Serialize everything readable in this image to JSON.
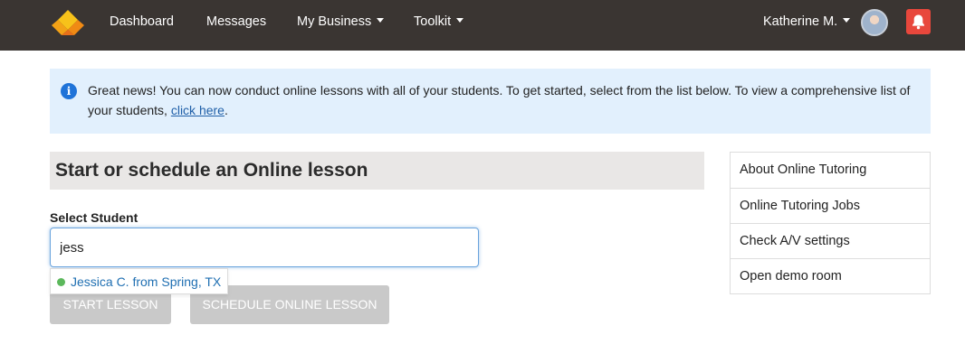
{
  "nav": {
    "links": [
      "Dashboard",
      "Messages",
      "My Business",
      "Toolkit"
    ],
    "user_name": "Katherine M.",
    "logo_icon": "diamond-logo-icon",
    "bell_icon": "bell-icon",
    "bell_color": "#e8473c",
    "bar_color": "#3a3532"
  },
  "alert": {
    "icon": "info-icon",
    "text_before": "Great news! You can now conduct online lessons with all of your students. To get started, select from the list below. To view a comprehensive list of your students, ",
    "link_text": "click here",
    "text_after": "."
  },
  "main": {
    "title": "Start or schedule an Online lesson",
    "select_label": "Select Student",
    "input_value": "jess",
    "suggestion": "Jessica C. from Spring, TX",
    "start_button": "START LESSON",
    "schedule_button": "SCHEDULE ONLINE LESSON"
  },
  "sidebar": {
    "items": [
      "About Online Tutoring",
      "Online Tutoring Jobs",
      "Check A/V settings",
      "Open demo room"
    ]
  }
}
